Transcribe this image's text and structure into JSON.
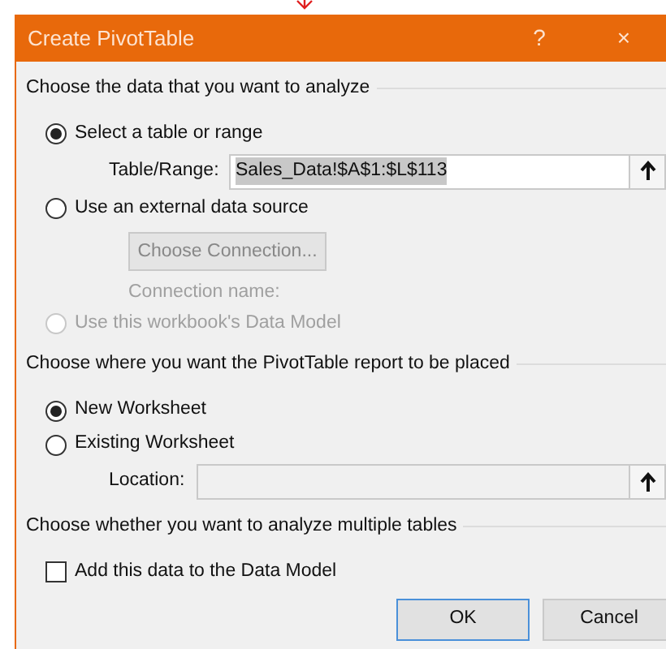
{
  "window": {
    "title": "Create PivotTable",
    "help": "?",
    "close": "×"
  },
  "sections": [
    {
      "heading": "Choose the data that you want to analyze",
      "items": [
        {
          "kind": "radio",
          "label": "Select a table or range",
          "selected": true,
          "disabled": false
        },
        {
          "kind": "field",
          "label": "Table/Range:",
          "value": "Sales_Data!$A$1:$L$113",
          "value_selected": true,
          "disabled": false
        },
        {
          "kind": "radio",
          "label": "Use an external data source",
          "selected": false,
          "disabled": false
        },
        {
          "kind": "button",
          "label": "Choose Connection...",
          "disabled": true
        },
        {
          "kind": "note",
          "label": "Connection name:",
          "disabled": true
        },
        {
          "kind": "radio",
          "label": "Use this workbook's Data Model",
          "selected": false,
          "disabled": true
        }
      ]
    },
    {
      "heading": "Choose where you want the PivotTable report to be placed",
      "items": [
        {
          "kind": "radio",
          "label": "New Worksheet",
          "selected": true,
          "disabled": false
        },
        {
          "kind": "radio",
          "label": "Existing Worksheet",
          "selected": false,
          "disabled": false
        },
        {
          "kind": "field",
          "label": "Location:",
          "disabled": true
        }
      ]
    },
    {
      "heading": "Choose whether you want to analyze multiple tables",
      "items": [
        {
          "kind": "checkbox",
          "label": "Add this data to the Data Model",
          "checked": false,
          "disabled": false
        }
      ]
    }
  ],
  "buttons": [
    {
      "label": "OK",
      "default": true
    },
    {
      "label": "Cancel",
      "default": false
    }
  ]
}
